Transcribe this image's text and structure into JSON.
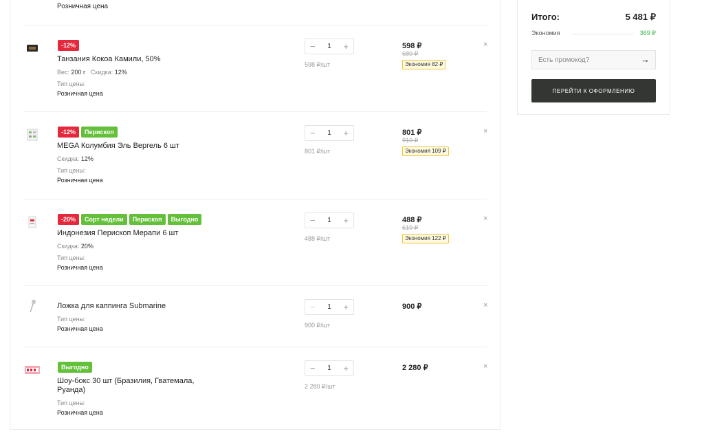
{
  "cart": {
    "top_remnant_value": "Розничная цена",
    "items": [
      {
        "badges": [
          {
            "text": "-12%",
            "color": "red"
          }
        ],
        "name": "Танзания Кокоа Камили, 50%",
        "meta": [
          {
            "label": "Вес:",
            "value": "200 г"
          },
          {
            "label": "Скидка:",
            "value": "12%"
          }
        ],
        "price_type_label": "Тип цены:",
        "price_type_value": "Розничная цена",
        "qty": "1",
        "unit_price": "598 ₽/шт",
        "price": "598 ₽",
        "old_price": "680 ₽",
        "economy": "Экономия  82 ₽",
        "thumb_icon": "coffee-pack-icon"
      },
      {
        "badges": [
          {
            "text": "-12%",
            "color": "red"
          },
          {
            "text": "Перископ",
            "color": "green"
          }
        ],
        "name": "MEGA Колумбия Эль Вергель 6 шт",
        "meta": [
          {
            "label": "Скидка:",
            "value": "12%"
          }
        ],
        "price_type_label": "Тип цены:",
        "price_type_value": "Розничная цена",
        "qty": "1",
        "unit_price": "801 ₽/шт",
        "price": "801 ₽",
        "old_price": "910 ₽",
        "economy": "Экономия  109 ₽",
        "thumb_icon": "capsule-box-icon"
      },
      {
        "badges": [
          {
            "text": "-20%",
            "color": "red"
          },
          {
            "text": "Сорт недели",
            "color": "green"
          },
          {
            "text": "Перископ",
            "color": "green"
          },
          {
            "text": "Выгодно",
            "color": "green"
          }
        ],
        "name": "Индонезия Перископ Мерапи 6 шт",
        "meta": [
          {
            "label": "Скидка:",
            "value": "20%"
          }
        ],
        "price_type_label": "Тип цены:",
        "price_type_value": "Розничная цена",
        "qty": "1",
        "unit_price": "488 ₽/шт",
        "price": "488 ₽",
        "old_price": "610 ₽",
        "economy": "Экономия  122 ₽",
        "thumb_icon": "drip-bag-icon"
      },
      {
        "badges": [],
        "name": "Ложка для каппинга Submarine",
        "meta": [],
        "price_type_label": "Тип цены:",
        "price_type_value": "Розничная цена",
        "qty": "1",
        "unit_price": "900 ₽/шт",
        "price": "900 ₽",
        "old_price": "",
        "economy": "",
        "thumb_icon": "spoon-icon"
      },
      {
        "badges": [
          {
            "text": "Выгодно",
            "color": "green"
          }
        ],
        "name": "Шоу-бокс 30 шт (Бразилия, Гватемала, Руанда)",
        "meta": [],
        "price_type_label": "Тип цены:",
        "price_type_value": "Розничная цена",
        "qty": "1",
        "unit_price": "2 280 ₽/шт",
        "price": "2 280 ₽",
        "old_price": "",
        "economy": "",
        "thumb_icon": "show-box-icon"
      }
    ]
  },
  "summary": {
    "total_label": "Итого:",
    "total_value": "5 481 ₽",
    "savings_label": "Экономия",
    "savings_value": "369 ₽",
    "promo_placeholder": "Есть промокод?",
    "checkout_label": "ПЕРЕЙТИ К ОФОРМЛЕНИЮ"
  },
  "colors": {
    "badge_red": "#e5283b",
    "badge_green": "#64bf3b",
    "economy_border": "#f0c43a",
    "savings_green": "#3bb54a",
    "checkout_bg": "#333632"
  }
}
